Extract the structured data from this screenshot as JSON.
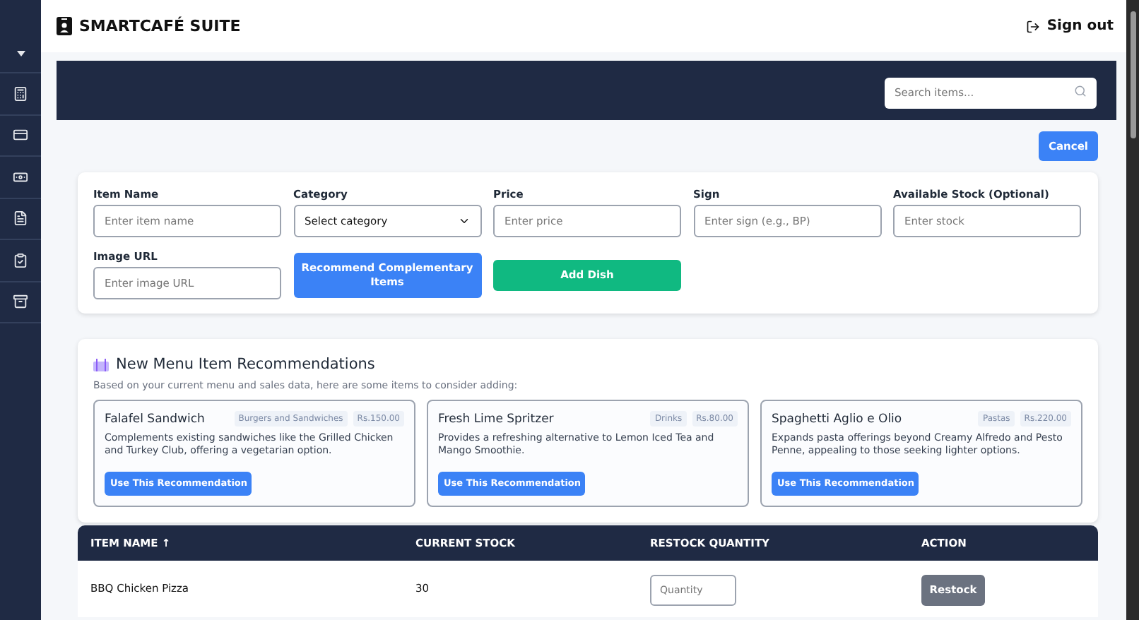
{
  "app": {
    "title": "SMARTCAFÉ SUITE",
    "sign_out": "Sign out"
  },
  "search": {
    "placeholder": "Search items..."
  },
  "cancel_button": "Cancel",
  "form": {
    "fields": [
      {
        "kind": "input",
        "label": "Item Name",
        "placeholder": "Enter item name"
      },
      {
        "kind": "select",
        "label": "Category",
        "value": "Select category"
      },
      {
        "kind": "input",
        "label": "Price",
        "placeholder": "Enter price"
      },
      {
        "kind": "input",
        "label": "Sign",
        "placeholder": "Enter sign (e.g., BP)"
      },
      {
        "kind": "input",
        "label": "Available Stock (Optional)",
        "placeholder": "Enter stock"
      },
      {
        "kind": "input",
        "label": "Image URL",
        "placeholder": "Enter image URL"
      }
    ],
    "recommend_button": "Recommend Complementary Items",
    "add_button": "Add Dish"
  },
  "recommendations": {
    "title": "New Menu Item Recommendations",
    "subtitle": "Based on your current menu and sales data, here are some items to consider adding:",
    "items": [
      {
        "name": "Falafel Sandwich",
        "category": "Burgers and Sandwiches",
        "price": "Rs.150.00",
        "description": "Complements existing sandwiches like the Grilled Chicken and Turkey Club, offering a vegetarian option.",
        "button": "Use This Recommendation"
      },
      {
        "name": "Fresh Lime Spritzer",
        "category": "Drinks",
        "price": "Rs.80.00",
        "description": "Provides a refreshing alternative to Lemon Iced Tea and Mango Smoothie.",
        "button": "Use This Recommendation"
      },
      {
        "name": "Spaghetti Aglio e Olio",
        "category": "Pastas",
        "price": "Rs.220.00",
        "description": "Expands pasta offerings beyond Creamy Alfredo and Pesto Penne, appealing to those seeking lighter options.",
        "button": "Use This Recommendation"
      }
    ]
  },
  "table": {
    "columns": [
      "ITEM NAME ↑",
      "CURRENT STOCK",
      "RESTOCK QUANTITY",
      "ACTION"
    ],
    "rows": [
      {
        "item_name": "BBQ Chicken Pizza",
        "current_stock": "30",
        "quantity_placeholder": "Quantity",
        "action": "Restock"
      }
    ]
  }
}
